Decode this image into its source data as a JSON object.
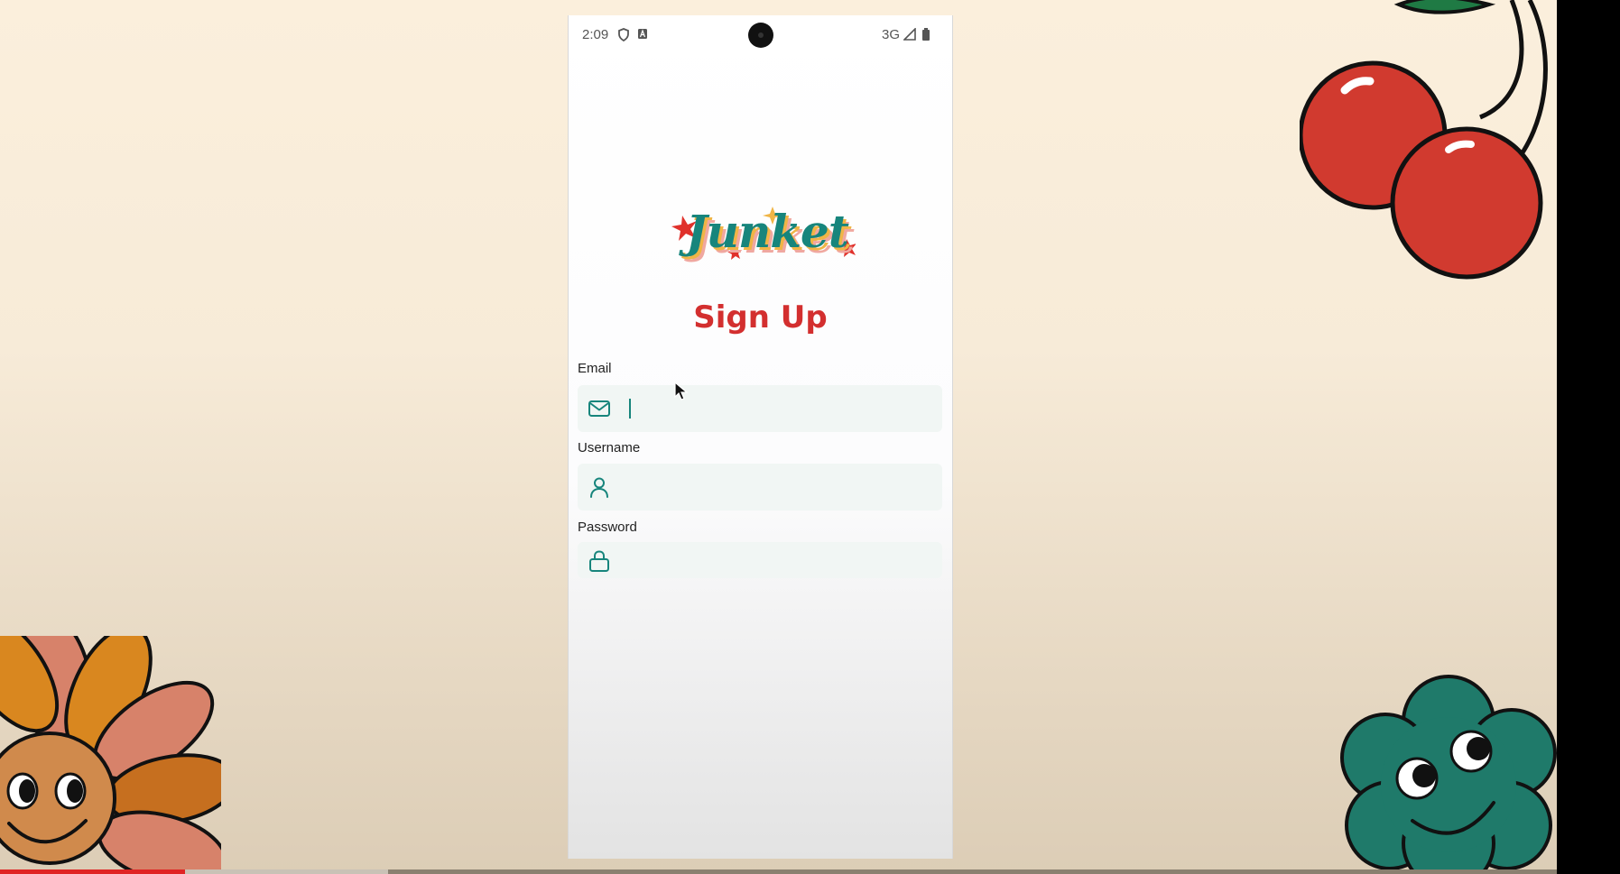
{
  "status_bar": {
    "time": "2:09",
    "network": "3G",
    "icons": [
      "shield-icon",
      "a-badge-icon",
      "signal-icon",
      "battery-icon"
    ]
  },
  "app": {
    "logo_text": "Junket",
    "title": "Sign Up",
    "accent_color": "#17857c",
    "title_color": "#d32f2f"
  },
  "form": {
    "email": {
      "label": "Email",
      "value": "",
      "icon": "mail-icon"
    },
    "username": {
      "label": "Username",
      "value": "",
      "icon": "user-icon"
    },
    "password": {
      "label": "Password",
      "value": "",
      "icon": "lock-icon"
    }
  }
}
